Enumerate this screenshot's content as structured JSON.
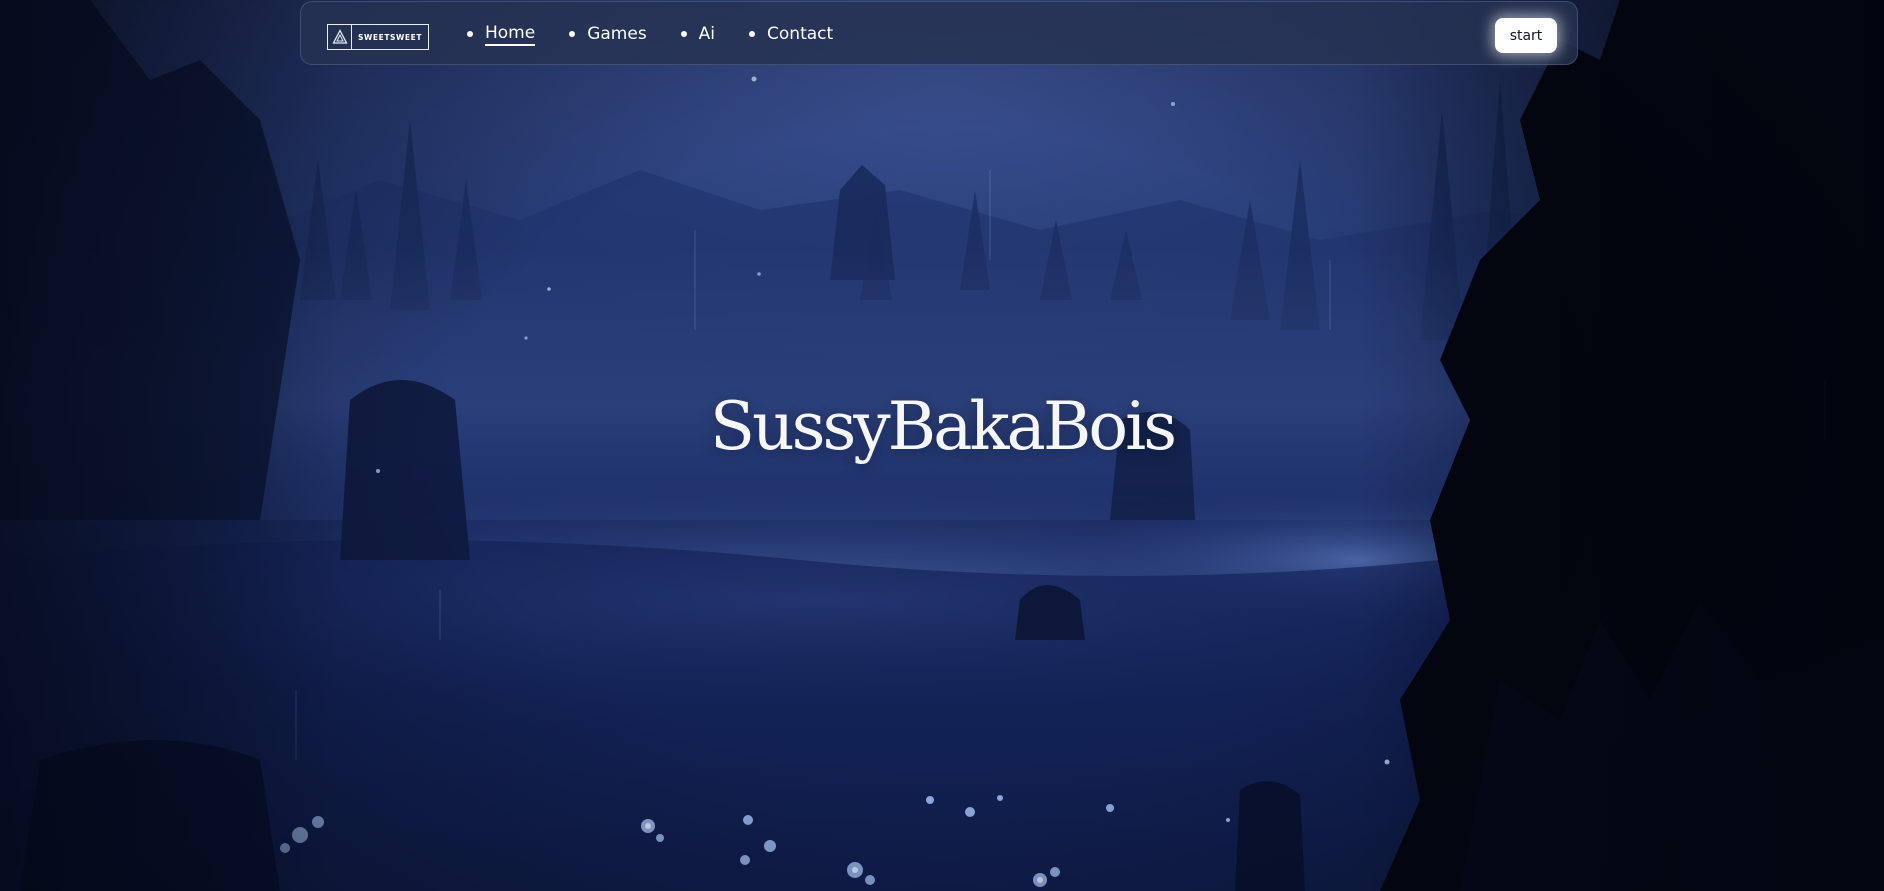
{
  "brand": {
    "name": "SWEETSWEET",
    "logo_icon": "triangle-logo-icon"
  },
  "nav": {
    "items": [
      {
        "label": "Home",
        "active": true
      },
      {
        "label": "Games",
        "active": false
      },
      {
        "label": "Ai",
        "active": false
      },
      {
        "label": "Contact",
        "active": false
      }
    ],
    "cta_label": "start"
  },
  "hero": {
    "title": "SussyBakaBois",
    "background": "night-forest-scene"
  },
  "colors": {
    "nav_background": "#263252",
    "text": "#ffffff",
    "sky": "#2c3f78",
    "meadow_glow": "#8fb3ff",
    "button_bg": "#ffffff",
    "button_text": "#111827"
  }
}
